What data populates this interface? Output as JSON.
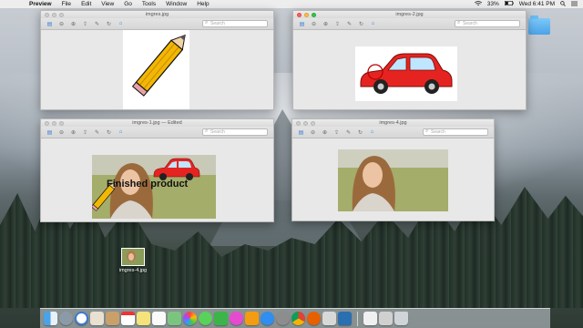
{
  "menubar": {
    "app_name": "Preview",
    "items": [
      "File",
      "Edit",
      "View",
      "Go",
      "Tools",
      "Window",
      "Help"
    ],
    "battery": "33%",
    "clock": "Wed 6:41 PM"
  },
  "windows": {
    "top_left": {
      "title": "imgres.jpg"
    },
    "top_right": {
      "title": "imgres-2.jpg"
    },
    "bottom_left": {
      "title": "imgres-1.jpg — Edited"
    },
    "bottom_right": {
      "title": "imgres-4.jpg"
    }
  },
  "toolbar": {
    "search_placeholder": "Search"
  },
  "canvas_text": {
    "finished_product": "Finished product"
  },
  "desktop": {
    "file_label": "imgres-4.jpg"
  },
  "colors": {
    "accent": "#3a7bd5",
    "pencil_body": "#f2b705",
    "car_red": "#e52421"
  },
  "dock": {
    "icons": [
      "finder",
      "launchpad",
      "safari",
      "mail",
      "contacts",
      "calendar",
      "notes",
      "reminders",
      "maps",
      "photos",
      "messages",
      "facetime",
      "itunes",
      "ibooks",
      "app-store",
      "system-preferences",
      "chrome",
      "firefox",
      "preview",
      "other",
      "trash"
    ]
  }
}
